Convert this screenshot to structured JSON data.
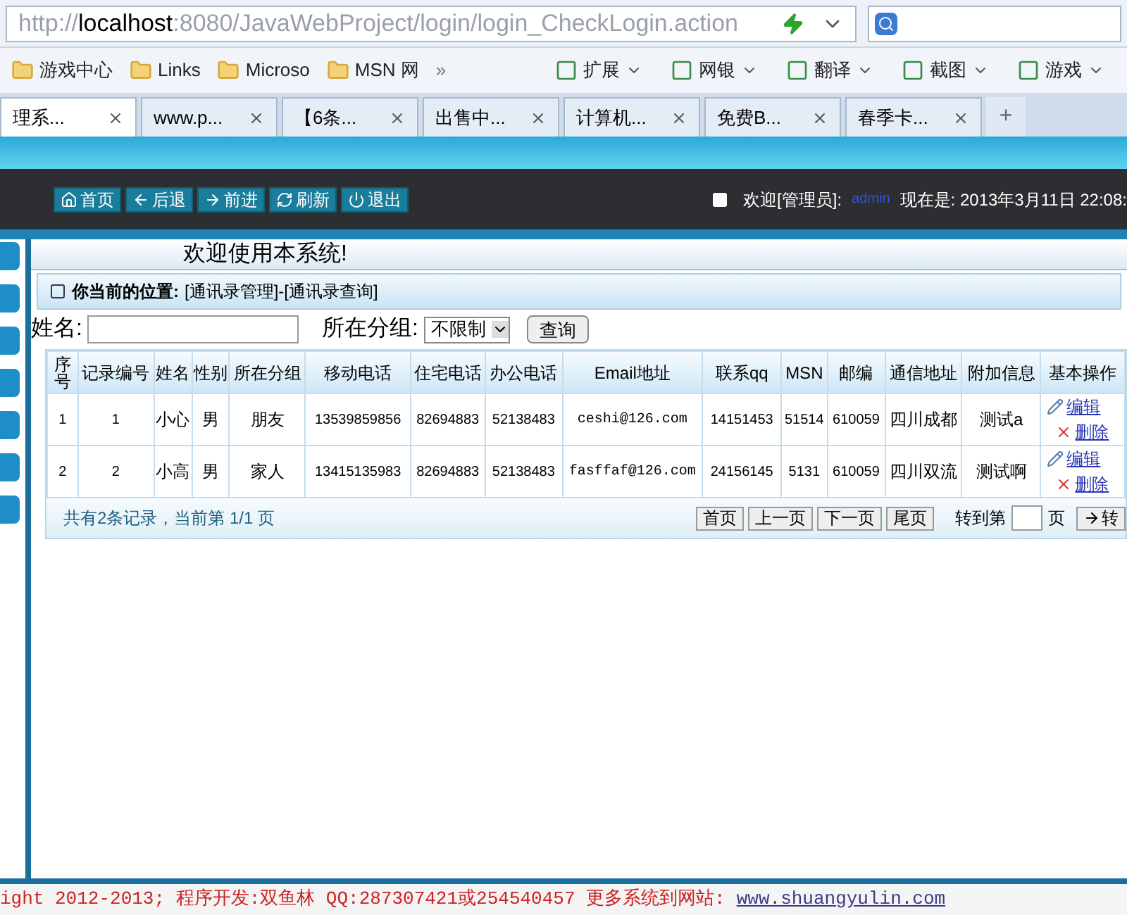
{
  "address_bar": {
    "url": "http://**localhost**:8080/JavaWebProject/login/login_CheckLogin.action"
  },
  "bookmarks": [
    {
      "label": "游戏中心"
    },
    {
      "label": "Links"
    },
    {
      "label": "Microso"
    },
    {
      "label": "MSN 网"
    }
  ],
  "bookmarks_more": "»",
  "tools": [
    {
      "label": "扩展"
    },
    {
      "label": "网银"
    },
    {
      "label": "翻译"
    },
    {
      "label": "截图"
    },
    {
      "label": "游戏"
    }
  ],
  "tabs": [
    {
      "label": "理系...",
      "selected": true
    },
    {
      "label": "www.p...",
      "selected": false
    },
    {
      "label": "【6条...",
      "selected": false
    },
    {
      "label": "出售中...",
      "selected": false
    },
    {
      "label": "计算机...",
      "selected": false
    },
    {
      "label": "免费B...",
      "selected": false
    },
    {
      "label": "春季卡...",
      "selected": false
    }
  ],
  "new_tab": "+",
  "nav_buttons": [
    {
      "label": "首页"
    },
    {
      "label": "后退"
    },
    {
      "label": "前进"
    },
    {
      "label": "刷新"
    },
    {
      "label": "退出"
    }
  ],
  "welcome": {
    "greeting": "欢迎[管理员]:",
    "user": "admin",
    "time": "现在是: 2013年3月11日 22:08:"
  },
  "title": "欢迎使用本系统!",
  "location": {
    "label": "你当前的位置:",
    "path": "[通讯录管理]-[通讯录查询]"
  },
  "search": {
    "name_label": "姓名:",
    "group_label": "所在分组:",
    "group_value": "不限制",
    "button": "查询"
  },
  "table": {
    "columns": [
      "序号",
      "记录编号",
      "姓名",
      "性别",
      "所在分组",
      "移动电话",
      "住宅电话",
      "办公电话",
      "Email地址",
      "联系qq",
      "MSN",
      "邮编",
      "通信地址",
      "附加信息",
      "基本操作"
    ],
    "rows": [
      {
        "cells": [
          "1",
          "1",
          "小心",
          "男",
          "朋友",
          "13539859856",
          "82694883",
          "52138483",
          "ceshi@126.com",
          "14151453",
          "51514",
          "610059",
          "四川成都",
          "测试a"
        ],
        "edit": "编辑",
        "delete": "删除"
      },
      {
        "cells": [
          "2",
          "2",
          "小高",
          "男",
          "家人",
          "13415135983",
          "82694883",
          "52138483",
          "fasffaf@126.com",
          "24156145",
          "5131",
          "610059",
          "四川双流",
          "测试啊"
        ],
        "edit": "编辑",
        "delete": "删除"
      }
    ]
  },
  "pagination": {
    "summary": "共有2条记录，当前第 1/1 页",
    "buttons": [
      "首页",
      "上一页",
      "下一页",
      "尾页"
    ],
    "goto_label": "转到第",
    "page_label": "页",
    "go_button": "转"
  },
  "footer": {
    "text": "ight 2012-2013; 程序开发:双鱼林  QQ:287307421或254540457  更多系统到网站:",
    "link": "www.shuangyulin.com"
  }
}
